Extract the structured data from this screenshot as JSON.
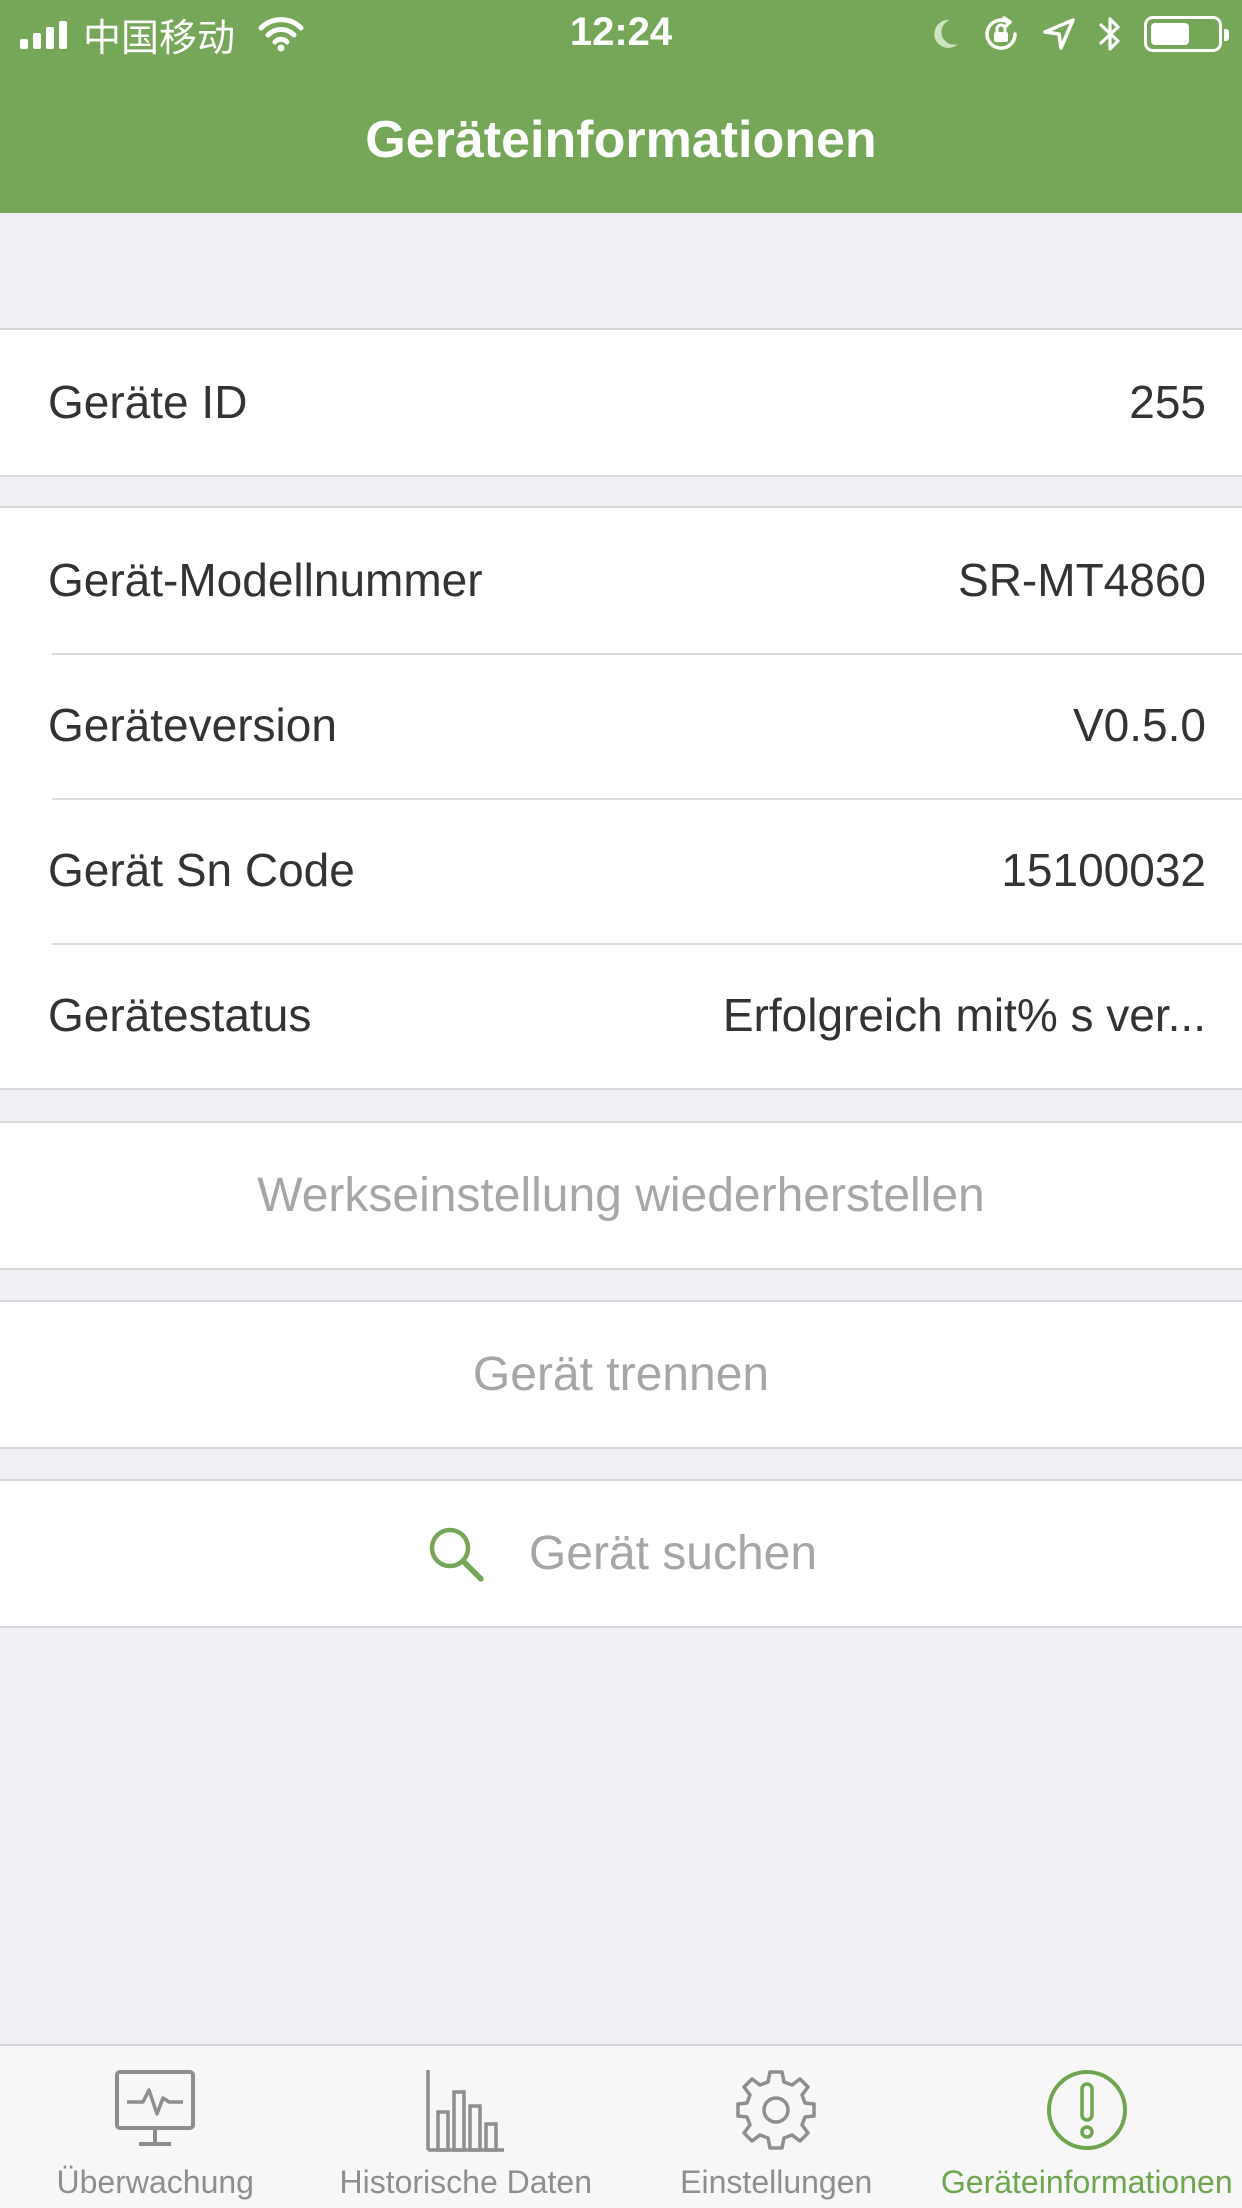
{
  "status_bar": {
    "carrier": "中国移动",
    "time": "12:24"
  },
  "header": {
    "title": "Geräteinformationen"
  },
  "groups": {
    "id": [
      {
        "label": "Geräte ID",
        "value": "255"
      }
    ],
    "info": [
      {
        "label": "Gerät-Modellnummer",
        "value": "SR-MT4860"
      },
      {
        "label": "Geräteversion",
        "value": "V0.5.0"
      },
      {
        "label": "Gerät Sn Code",
        "value": "15100032"
      },
      {
        "label": "Gerätestatus",
        "value": "Erfolgreich mit% s ver..."
      }
    ]
  },
  "actions": {
    "factory_reset": "Werkseinstellung wiederherstellen",
    "disconnect": "Gerät trennen",
    "search": "Gerät suchen"
  },
  "tabbar": {
    "tabs": [
      {
        "label": "Überwachung",
        "icon": "monitor-icon"
      },
      {
        "label": "Historische Daten",
        "icon": "bar-chart-icon"
      },
      {
        "label": "Einstellungen",
        "icon": "gear-icon"
      },
      {
        "label": "Geräteinformationen",
        "icon": "info-icon"
      }
    ],
    "active_index": 3
  },
  "colors": {
    "accent": "#76a758",
    "active_tab": "#6ea64f",
    "muted_text": "#a6a6a6"
  }
}
